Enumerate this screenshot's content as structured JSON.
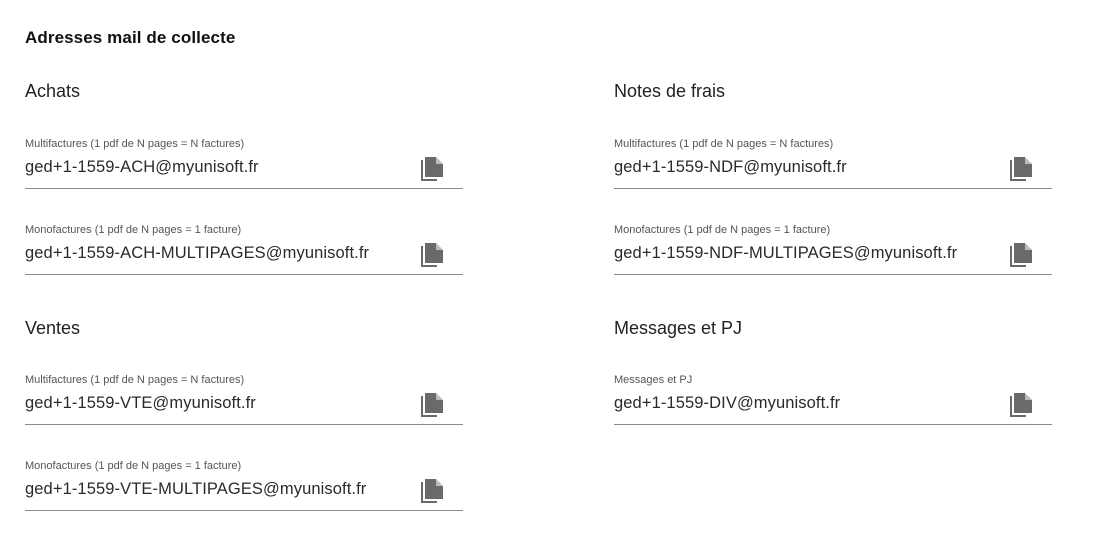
{
  "title": "Adresses mail de collecte",
  "icons": {
    "copy": "copy-icon",
    "color": "#666666"
  },
  "sections": {
    "achats": {
      "title": "Achats",
      "fields": [
        {
          "label": "Multifactures (1 pdf de N pages = N factures)",
          "value": "ged+1-1559-ACH@myunisoft.fr"
        },
        {
          "label": "Monofactures (1 pdf de N pages = 1 facture)",
          "value": "ged+1-1559-ACH-MULTIPAGES@myunisoft.fr"
        }
      ]
    },
    "ventes": {
      "title": "Ventes",
      "fields": [
        {
          "label": "Multifactures (1 pdf de N pages = N factures)",
          "value": "ged+1-1559-VTE@myunisoft.fr"
        },
        {
          "label": "Monofactures (1 pdf de N pages = 1 facture)",
          "value": "ged+1-1559-VTE-MULTIPAGES@myunisoft.fr"
        }
      ]
    },
    "notes_de_frais": {
      "title": "Notes de frais",
      "fields": [
        {
          "label": "Multifactures (1 pdf de N pages = N factures)",
          "value": "ged+1-1559-NDF@myunisoft.fr"
        },
        {
          "label": "Monofactures (1 pdf de N pages = 1 facture)",
          "value": "ged+1-1559-NDF-MULTIPAGES@myunisoft.fr"
        }
      ]
    },
    "messages_pj": {
      "title": "Messages et PJ",
      "fields": [
        {
          "label": "Messages et PJ",
          "value": "ged+1-1559-DIV@myunisoft.fr"
        }
      ]
    }
  }
}
